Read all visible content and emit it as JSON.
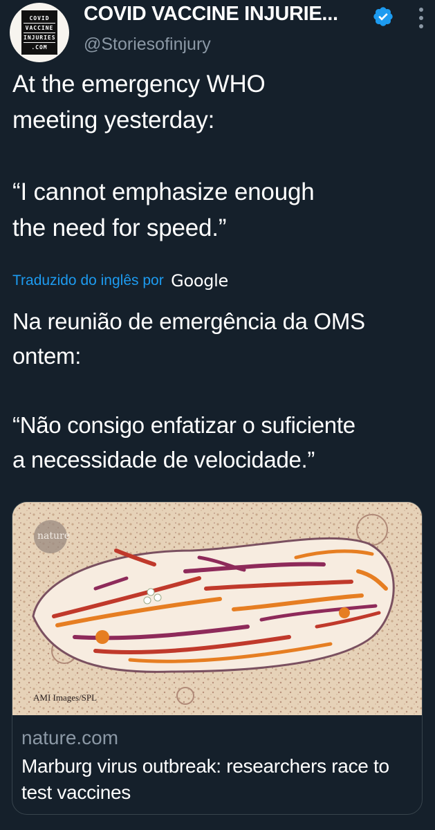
{
  "tweet": {
    "author": {
      "display_name": "COVID VACCINE INJURIE...",
      "handle": "@Storiesofinjury",
      "avatar_lines": [
        "COVID",
        "VACCINE",
        "INJURIES",
        ".COM"
      ],
      "verified": true
    },
    "text_lines": [
      "At the emergency WHO",
      "meeting yesterday:",
      "",
      "“I cannot emphasize enough",
      "the need for speed.”"
    ],
    "translation": {
      "label": "Traduzido do inglês por",
      "provider": "Google",
      "text_lines": [
        "Na reunião de emergência da OMS",
        "ontem:",
        "",
        "“Não consigo enfatizar o suficiente",
        "a necessidade de velocidade.”"
      ]
    },
    "link_card": {
      "image_watermark": "nature",
      "image_credit": "AMI Images/SPL",
      "domain": "nature.com",
      "title": "Marburg virus outbreak: researchers race to test vaccines"
    }
  },
  "colors": {
    "background": "#15202b",
    "text": "#ffffff",
    "secondary_text": "#8b98a5",
    "link": "#1d9bf0",
    "verified_badge": "#1d9bf0",
    "card_border": "#38444d"
  },
  "icons": {
    "verified": "verified-badge-icon",
    "more": "more-options-icon"
  }
}
